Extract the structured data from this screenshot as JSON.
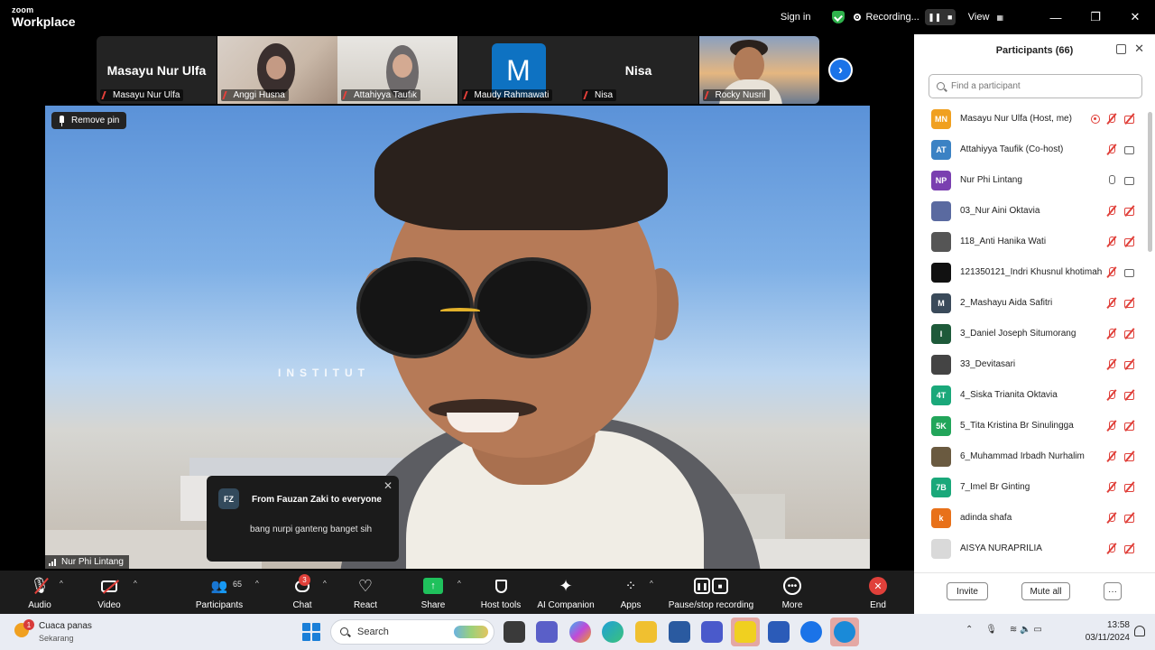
{
  "topbar": {
    "logo_small": "zoom",
    "logo_big": "Workplace",
    "sign_in": "Sign in",
    "recording_label": "Recording...",
    "view_label": "View"
  },
  "thumbnails": [
    {
      "big_name": "Masayu Nur Ulfa",
      "name": "Masayu Nur Ulfa"
    },
    {
      "big_name": "",
      "name": "Anggi Husna"
    },
    {
      "big_name": "",
      "name": "Attahiyya Taufik"
    },
    {
      "big_name": "M",
      "name": "Maudy Rahmawati"
    },
    {
      "big_name": "Nisa",
      "name": "Nisa"
    },
    {
      "big_name": "",
      "name": "Rocky Nusril"
    }
  ],
  "main_video": {
    "pin_label": "Remove pin",
    "speaker_name": "Nur Phi Lintang",
    "background_text": "INSTITUT"
  },
  "chat_popup": {
    "initials": "FZ",
    "from": "From Fauzan Zaki to everyone",
    "message": "bang nurpi ganteng banget sih"
  },
  "toolbar": {
    "audio": "Audio",
    "video": "Video",
    "participants": "Participants",
    "participants_count": "65",
    "chat": "Chat",
    "chat_badge": "3",
    "react": "React",
    "share": "Share",
    "host_tools": "Host tools",
    "ai_companion": "AI Companion",
    "apps": "Apps",
    "pause_stop_recording": "Pause/stop recording",
    "more": "More",
    "end": "End"
  },
  "panel": {
    "title": "Participants (66)",
    "search_placeholder": "Find a participant",
    "invite": "Invite",
    "mute_all": "Mute all",
    "more": "···",
    "participants": [
      {
        "initials": "MN",
        "color": "#f0a020",
        "name": "Masayu Nur Ulfa (Host, me)",
        "mic": "off",
        "cam": "off",
        "recording": true
      },
      {
        "initials": "AT",
        "color": "#3b82c4",
        "name": "Attahiyya Taufik (Co-host)",
        "mic": "off",
        "cam": "on",
        "recording": false
      },
      {
        "initials": "NP",
        "color": "#7a3fb0",
        "name": "Nur Phi Lintang",
        "mic": "on",
        "cam": "on",
        "recording": false
      },
      {
        "initials": "",
        "color": "#5a6aa0",
        "name": "03_Nur Aini Oktavia",
        "mic": "off",
        "cam": "off",
        "recording": false
      },
      {
        "initials": "",
        "color": "#555555",
        "name": "118_Anti Hanika Wati",
        "mic": "off",
        "cam": "off",
        "recording": false
      },
      {
        "initials": "",
        "color": "#111111",
        "name": "121350121_Indri Khusnul khotimah",
        "mic": "off",
        "cam": "on",
        "recording": false
      },
      {
        "initials": "M",
        "color": "#3a4a5a",
        "name": "2_Mashayu Aida Safitri",
        "mic": "off",
        "cam": "off",
        "recording": false
      },
      {
        "initials": "I",
        "color": "#1e5a3a",
        "name": "3_Daniel Joseph Situmorang",
        "mic": "off",
        "cam": "off",
        "recording": false
      },
      {
        "initials": "",
        "color": "#444444",
        "name": "33_Devitasari",
        "mic": "off",
        "cam": "off",
        "recording": false
      },
      {
        "initials": "4T",
        "color": "#1aa87a",
        "name": "4_Siska Trianita Oktavia",
        "mic": "off",
        "cam": "off",
        "recording": false
      },
      {
        "initials": "5K",
        "color": "#22a55a",
        "name": "5_Tita Kristina Br Sinulingga",
        "mic": "off",
        "cam": "off",
        "recording": false
      },
      {
        "initials": "",
        "color": "#6a5a40",
        "name": "6_Muhammad Irbadh Nurhalim",
        "mic": "off",
        "cam": "off",
        "recording": false
      },
      {
        "initials": "7B",
        "color": "#1aa87a",
        "name": "7_Imel Br Ginting",
        "mic": "off",
        "cam": "off",
        "recording": false
      },
      {
        "initials": "k",
        "color": "#e8711a",
        "name": "adinda shafa",
        "mic": "off",
        "cam": "off",
        "recording": false
      },
      {
        "initials": "",
        "color": "#d9d9d9",
        "name": "AISYA NURAPRILIA",
        "mic": "off",
        "cam": "off",
        "recording": false
      }
    ]
  },
  "taskbar": {
    "weather_title": "Cuaca panas",
    "weather_sub": "Sekarang",
    "weather_badge": "1",
    "search": "Search",
    "time": "13:58",
    "date": "03/11/2024"
  }
}
